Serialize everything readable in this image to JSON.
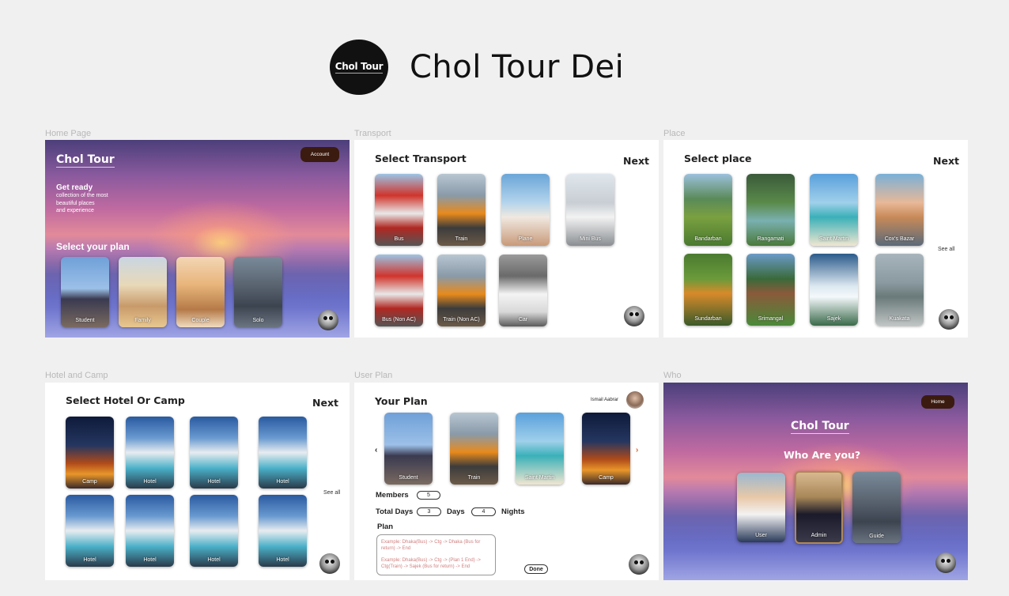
{
  "header": {
    "logo_text": "Chol Tour",
    "app_title": "Chol Tour Dei"
  },
  "frames": {
    "home": {
      "label": "Home Page",
      "brand": "Chol Tour",
      "account_button": "Account",
      "hero_title": "Get ready",
      "hero_line1": "collection of the most",
      "hero_line2": "beautiful places",
      "hero_line3": "and experience",
      "plan_heading": "Select your plan",
      "plans": [
        "Student",
        "Family",
        "Couple",
        "Solo"
      ]
    },
    "transport": {
      "label": "Transport",
      "title": "Select  Transport",
      "next": "Next",
      "items": [
        "Bus",
        "Train",
        "Plane",
        "Mini Bus",
        "Bus (Non AC)",
        "Train (Non AC)",
        "Car"
      ]
    },
    "place": {
      "label": "Place",
      "title": "Select  place",
      "next": "Next",
      "see_all": "See all",
      "items": [
        "Bandarban",
        "Rangamati",
        "Saint Martin",
        "Cox's Bazar",
        "Sundarban",
        "Srimangal",
        "Sajek",
        "Kuakata"
      ]
    },
    "hotel": {
      "label": "Hotel and Camp",
      "title": "Select  Hotel Or Camp",
      "next": "Next",
      "see_all": "See all",
      "items": [
        "Camp",
        "Hotel",
        "Hotel",
        "Hotel",
        "Hotel",
        "Hotel",
        "Hotel",
        "Hotel"
      ]
    },
    "userplan": {
      "label": "User Plan",
      "title": "Your Plan",
      "user_name": "Ismail Aabrar",
      "items": [
        "Student",
        "Train",
        "Saint Martin",
        "Camp"
      ],
      "members_label": "Members",
      "members_value": "5",
      "total_days_label": "Total Days",
      "days_value": "3",
      "days_label": "Days",
      "nights_value": "4",
      "nights_label": "Nights",
      "plan_label": "Plan",
      "plan_example1": "Example: Dhaka(Bus) -> Ctg -> Dhaka (Bus for return) -> End",
      "plan_example2": "Example: Dhaka(Bus) -> Ctg -> (Plan 1 End) -> Ctg(Train) -> Sajek (Bus for return) -> End",
      "done": "Done",
      "prev_arrow": "‹",
      "next_arrow": "›"
    },
    "who": {
      "label": "Who",
      "brand": "Chol Tour",
      "home_button": "Home",
      "title": "Who Are you?",
      "roles": [
        "User",
        "Admin",
        "Guide"
      ]
    }
  },
  "colors": {
    "accent_dark": "#3b1b0f",
    "arrow_orange": "#e0602a"
  }
}
